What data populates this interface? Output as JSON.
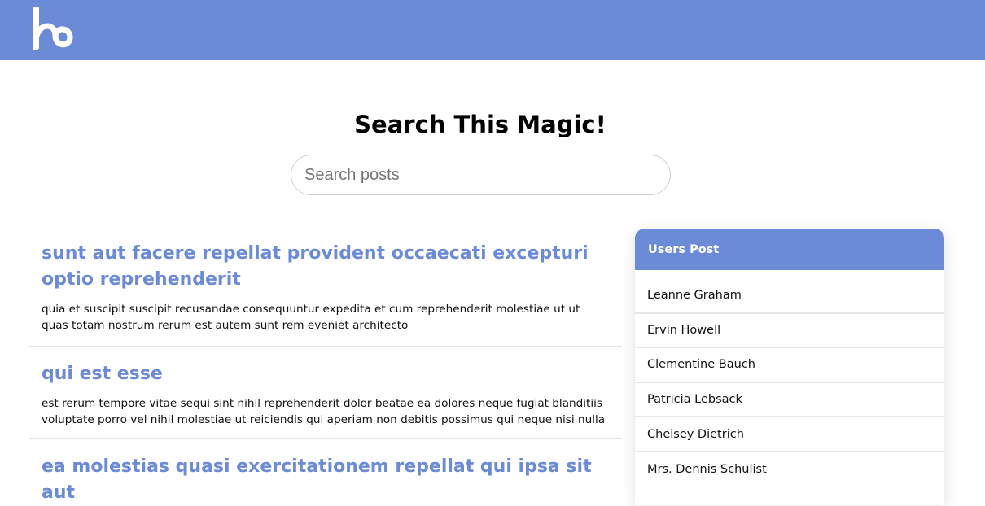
{
  "header": {
    "logo_icon": "hb-logo-icon",
    "background": "#6b8bd6"
  },
  "hero": {
    "title": "Search This Magic!"
  },
  "search": {
    "placeholder": "Search posts",
    "value": ""
  },
  "posts": [
    {
      "title": "sunt aut facere repellat provident occaecati excepturi optio reprehenderit",
      "body": "quia et suscipit suscipit recusandae consequuntur expedita et cum reprehenderit molestiae ut ut quas totam nostrum rerum est autem sunt rem eveniet architecto"
    },
    {
      "title": "qui est esse",
      "body": "est rerum tempore vitae sequi sint nihil reprehenderit dolor beatae ea dolores neque fugiat blanditiis voluptate porro vel nihil molestiae ut reiciendis qui aperiam non debitis possimus qui neque nisi nulla"
    },
    {
      "title": "ea molestias quasi exercitationem repellat qui ipsa sit aut",
      "body": ""
    }
  ],
  "users_panel": {
    "title": "Users Post",
    "users": [
      "Leanne Graham",
      "Ervin Howell",
      "Clementine Bauch",
      "Patricia Lebsack",
      "Chelsey Dietrich",
      "Mrs. Dennis Schulist"
    ]
  },
  "colors": {
    "accent": "#6b8bd6",
    "text": "#111111",
    "divider": "#e6e6e6"
  }
}
